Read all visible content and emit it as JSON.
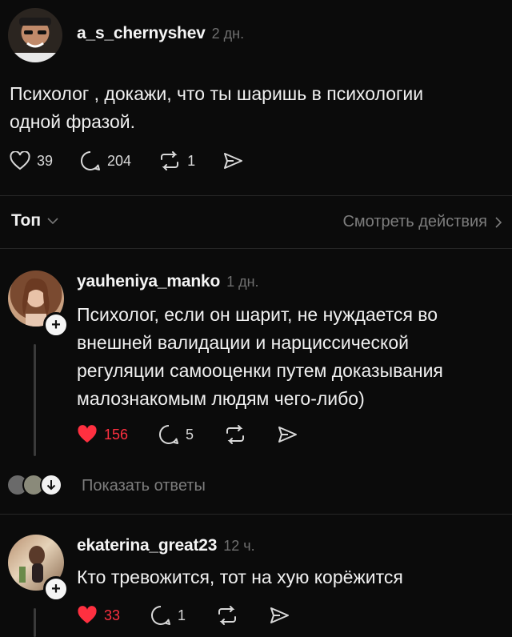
{
  "post": {
    "author": "a_s_chernyshev",
    "time": "2 дн.",
    "text_line1": "Психолог , докажи, что ты шаришь в психологии",
    "text_line2": "одной фразой.",
    "likes": "39",
    "comments": "204",
    "reposts": "1"
  },
  "sort": {
    "label": "Топ",
    "activity_link": "Смотреть действия"
  },
  "replies": [
    {
      "author": "yauheniya_manko",
      "time": "1 дн.",
      "lines": [
        "Психолог, если он шарит, не нуждается во",
        "внешней валидации и нарциссической",
        "регуляции самооценки путем доказывания",
        "малознакомым людям чего-либо)"
      ],
      "likes": "156",
      "comments": "5",
      "show_replies": "Показать ответы"
    },
    {
      "author": "ekaterina_great23",
      "time": "12 ч.",
      "lines": [
        "Кто тревожится, тот на хую корёжится"
      ],
      "likes": "33",
      "comments": "1"
    }
  ],
  "colors": {
    "background": "#0b0b0b",
    "like_active": "#ff3040",
    "muted": "#7d7d7d"
  },
  "icons": [
    "heart-icon",
    "comment-icon",
    "repost-icon",
    "share-icon",
    "chevron-down-icon",
    "chevron-right-icon",
    "plus-icon",
    "arrow-down-icon"
  ]
}
